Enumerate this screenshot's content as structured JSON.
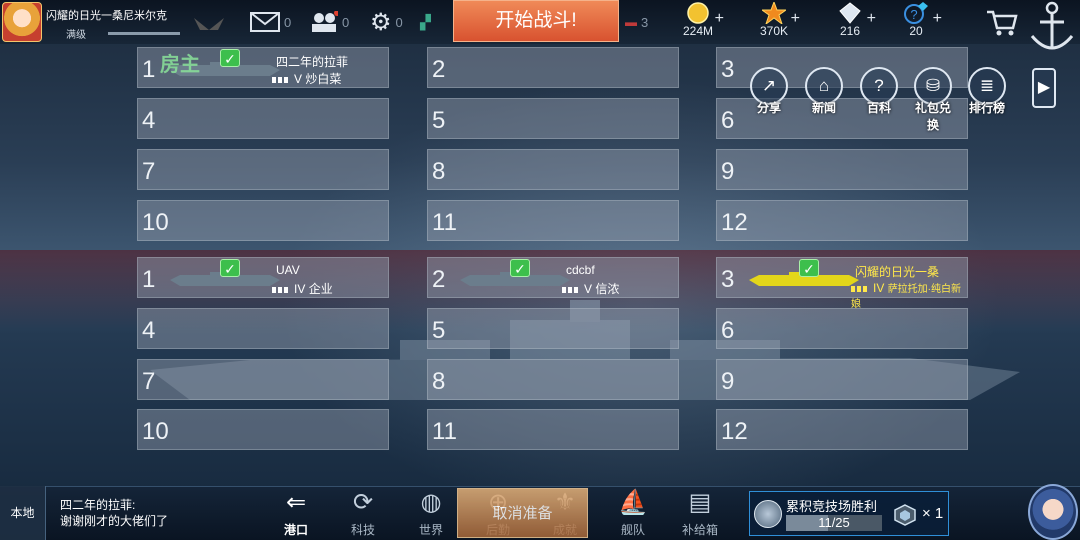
{
  "player": {
    "name": "闪耀的日光一桑尼米尔克",
    "level_label": "满级"
  },
  "topbar": {
    "mail_count": "0",
    "friends_count": "0",
    "settings_count": "0",
    "extra_count_1": "3",
    "extra_count_2": "0",
    "start_battle": "开始战斗!"
  },
  "resources": [
    {
      "icon": "gold-coin-icon",
      "value": "224M",
      "color": "#f2c230"
    },
    {
      "icon": "star-icon",
      "value": "370K",
      "color": "#f08a1e"
    },
    {
      "icon": "diamond-icon",
      "value": "216",
      "color": "#dfe8f2"
    },
    {
      "icon": "help-icon",
      "value": "20",
      "color": "#3a8fe0"
    }
  ],
  "room_owner_label": "房主",
  "team_top": {
    "slot_numbers": [
      "1",
      "2",
      "3",
      "4",
      "5",
      "6",
      "7",
      "8",
      "9",
      "10",
      "11",
      "12"
    ],
    "players": [
      {
        "slot": 0,
        "name": "四二年的拉菲",
        "tier": "V",
        "ship": "炒白菜"
      }
    ]
  },
  "team_bottom": {
    "slot_numbers": [
      "1",
      "2",
      "3",
      "4",
      "5",
      "6",
      "7",
      "8",
      "9",
      "10",
      "11",
      "12"
    ],
    "players": [
      {
        "slot": 0,
        "name": "UAV",
        "tier": "IV",
        "ship": "企业"
      },
      {
        "slot": 1,
        "name": "cdcbf",
        "tier": "V",
        "ship": "信浓"
      },
      {
        "slot": 2,
        "name": "闪耀的日光一桑",
        "tier": "IV",
        "ship": "萨拉托加·纯白新娘"
      }
    ]
  },
  "menu": [
    {
      "icon": "share-icon",
      "label": "分享",
      "glyph": "↗"
    },
    {
      "icon": "news-icon",
      "label": "新闻",
      "glyph": "⌂"
    },
    {
      "icon": "wiki-icon",
      "label": "百科",
      "glyph": "?"
    },
    {
      "icon": "gift-icon",
      "label": "礼包兑换",
      "glyph": "⛁"
    },
    {
      "icon": "ranking-icon",
      "label": "排行榜",
      "glyph": "≣"
    }
  ],
  "chat": {
    "channel": "本地",
    "line1": "四二年的拉菲:",
    "line2": "谢谢刚才的大佬们了"
  },
  "nav": [
    {
      "icon": "port-icon",
      "label": "港口"
    },
    {
      "icon": "tech-icon",
      "label": "科技"
    },
    {
      "icon": "world-icon",
      "label": "世界"
    },
    {
      "icon": "logistics-icon",
      "label": "后勤"
    },
    {
      "icon": "achievement-icon",
      "label": "成就"
    },
    {
      "icon": "fleet-icon",
      "label": "舰队"
    },
    {
      "icon": "supply-box-icon",
      "label": "补给箱"
    }
  ],
  "ready_button": "取消准备",
  "quest": {
    "title": "累积竞技场胜利",
    "progress": "11/25",
    "progress_fraction": 0.44,
    "reward_multiplier": "× 1"
  }
}
